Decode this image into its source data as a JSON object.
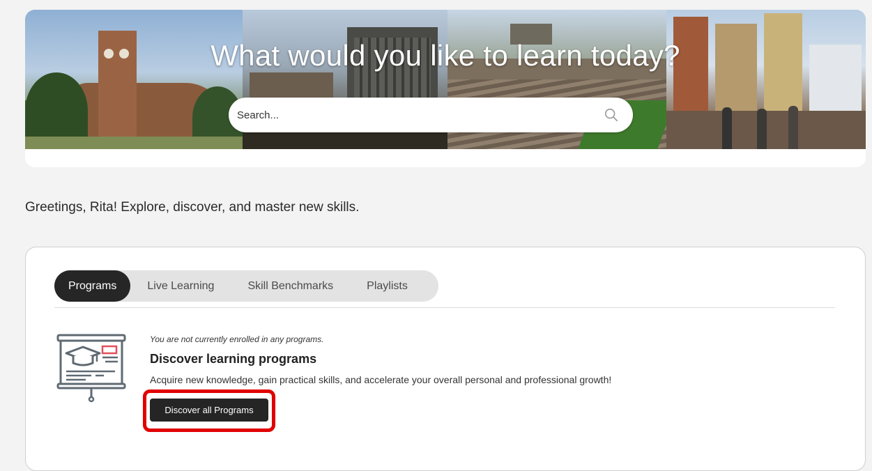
{
  "hero": {
    "title": "What would you like to learn today?",
    "search_placeholder": "Search..."
  },
  "greeting": "Greetings, Rita! Explore, discover, and master new skills.",
  "tabs": [
    {
      "label": "Programs",
      "active": true
    },
    {
      "label": "Live Learning",
      "active": false
    },
    {
      "label": "Skill Benchmarks",
      "active": false
    },
    {
      "label": "Playlists",
      "active": false
    }
  ],
  "programs": {
    "empty_message": "You are not currently enrolled in any programs.",
    "title": "Discover learning programs",
    "description": "Acquire new knowledge, gain practical skills, and accelerate your overall personal and professional growth!",
    "button_label": "Discover all Programs",
    "icon": "presentation-board-graduation-cap-icon"
  },
  "colors": {
    "highlight": "#e10000",
    "button_bg": "#252525",
    "active_tab_bg": "#262626",
    "tab_bar_bg": "#e3e3e3"
  }
}
